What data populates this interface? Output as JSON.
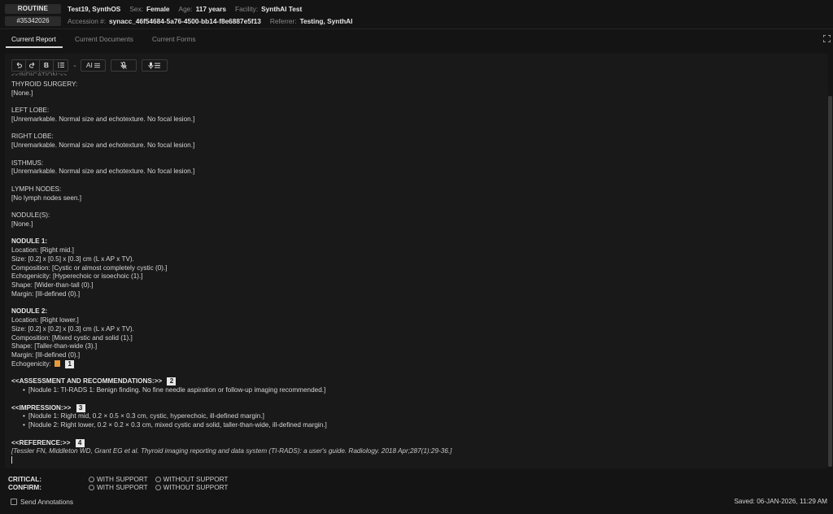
{
  "header": {
    "priority": "ROUTINE",
    "order_id": "#35342026",
    "patient_name": "Test19, SynthOS",
    "sex_label": "Sex:",
    "sex": "Female",
    "age_label": "Age:",
    "age": "117 years",
    "facility_label": "Facility:",
    "facility": "SynthAI Test",
    "accession_label": "Accession #:",
    "accession": "synacc_46f54684-5a76-4500-bb14-f8e6887e5f13",
    "referrer_label": "Referrer:",
    "referrer": "Testing, SynthAI"
  },
  "tabs": [
    {
      "label": "Current Report",
      "active": true
    },
    {
      "label": "Current Documents",
      "active": false
    },
    {
      "label": "Current Forms",
      "active": false
    }
  ],
  "toolbar": {
    "ai_label": "AI"
  },
  "report": {
    "cut_line": "<<INDICATION:>>",
    "thyroid_surgery_h": "THYROID SURGERY:",
    "thyroid_surgery_v": "[None.]",
    "left_lobe_h": "LEFT LOBE:",
    "left_lobe_v": "[Unremarkable. Normal size and echotexture. No focal lesion.]",
    "right_lobe_h": "RIGHT LOBE:",
    "right_lobe_v": "[Unremarkable. Normal size and echotexture. No focal lesion.]",
    "isthmus_h": "ISTHMUS:",
    "isthmus_v": "[Unremarkable. Normal size and echotexture. No focal lesion.]",
    "lymph_h": "LYMPH NODES:",
    "lymph_v": "[No lymph nodes seen.]",
    "nodules_h": "NODULE(S):",
    "nodules_v": "[None.]",
    "n1_h": "NODULE 1:",
    "n1_location": "Location: [Right mid.]",
    "n1_size": "Size: [0.2] x [0.5] x [0.3] cm (L x AP x TV).",
    "n1_composition": "Composition: [Cystic or almost completely cystic (0).]",
    "n1_echogenicity": "Echogenicity: [Hyperechoic or isoechoic (1).]",
    "n1_shape": "Shape: [Wider-than-tall (0).]",
    "n1_margin": "Margin: [Ill-defined (0).]",
    "n2_h": "NODULE 2:",
    "n2_location": "Location: [Right lower.]",
    "n2_size": "Size: [0.2] x [0.2] x [0.3] cm (L x AP x TV).",
    "n2_composition": "Composition: [Mixed cystic and solid (1).]",
    "n2_shape": "Shape: [Taller-than-wide (3).]",
    "n2_margin": "Margin: [Ill-defined (0).]",
    "n2_echogenicity": "Echogenicity:",
    "marker1": "1",
    "assess_h": "<<ASSESSMENT AND RECOMMENDATIONS:>>",
    "marker2": "2",
    "assess_1": "[Nodule 1: TI-RADS 1: Benign finding. No fine needle aspiration or follow-up imaging recommended.]",
    "impression_h": "<<IMPRESSION:>>",
    "marker3": "3",
    "impression_1": "[Nodule 1: Right mid, 0.2 × 0.5 × 0.3 cm, cystic, hyperechoic, ill-defined margin.]",
    "impression_2": "[Nodule 2: Right lower, 0.2 × 0.2 × 0.3 cm, mixed cystic and solid, taller-than-wide, ill-defined margin.]",
    "reference_h": "<<REFERENCE:>>",
    "marker4": "4",
    "reference_1": "[Tessler FN, Middleton WD, Grant EG et al. Thyroid imaging reporting and data system (TI-RADS): a user's guide. Radiology. 2018 Apr;287(1):29-36.]"
  },
  "fields": {
    "critical_label": "CRITICAL:",
    "confirm_label": "CONFIRM:",
    "with_support": "WITH SUPPORT",
    "without_support": "WITHOUT SUPPORT"
  },
  "footer": {
    "send_annotations": "Send Annotations",
    "saved": "Saved: 06-JAN-2026, 11:29 AM"
  },
  "colors": {
    "background": "#141414",
    "editor": "#191919",
    "highlight": "#e59b3c"
  }
}
